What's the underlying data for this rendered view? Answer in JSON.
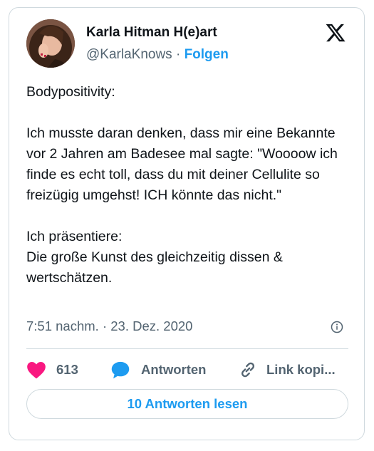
{
  "user": {
    "display_name": "Karla Hitman H(e)art",
    "handle": "@KarlaKnows",
    "separator": "·",
    "follow_label": "Folgen",
    "avatar_icon": "profile-photo"
  },
  "tweet": {
    "text": "Bodypositivity:\n\nIch musste daran denken, dass mir eine Bekannte vor 2 Jahren am Badesee mal sagte: \"Woooow ich finde es echt toll, dass du mit deiner Cellulite so freizügig umgehst! ICH könnte das nicht.\"\n\nIch präsentiere:\nDie große Kunst des gleichzeitig dissen & wertschätzen.",
    "timestamp": "7:51 nachm. · 23. Dez. 2020"
  },
  "actions": {
    "like_count": "613",
    "reply_label": "Antworten",
    "copy_link_label": "Link kopi..."
  },
  "read_replies_label": "10 Antworten lesen",
  "colors": {
    "accent": "#1d9bf0",
    "like": "#f91880",
    "text_secondary": "#536471",
    "border": "#cfd9de"
  },
  "icons": [
    "x-logo-icon",
    "info-icon",
    "heart-icon",
    "reply-bubble-icon",
    "link-icon"
  ]
}
